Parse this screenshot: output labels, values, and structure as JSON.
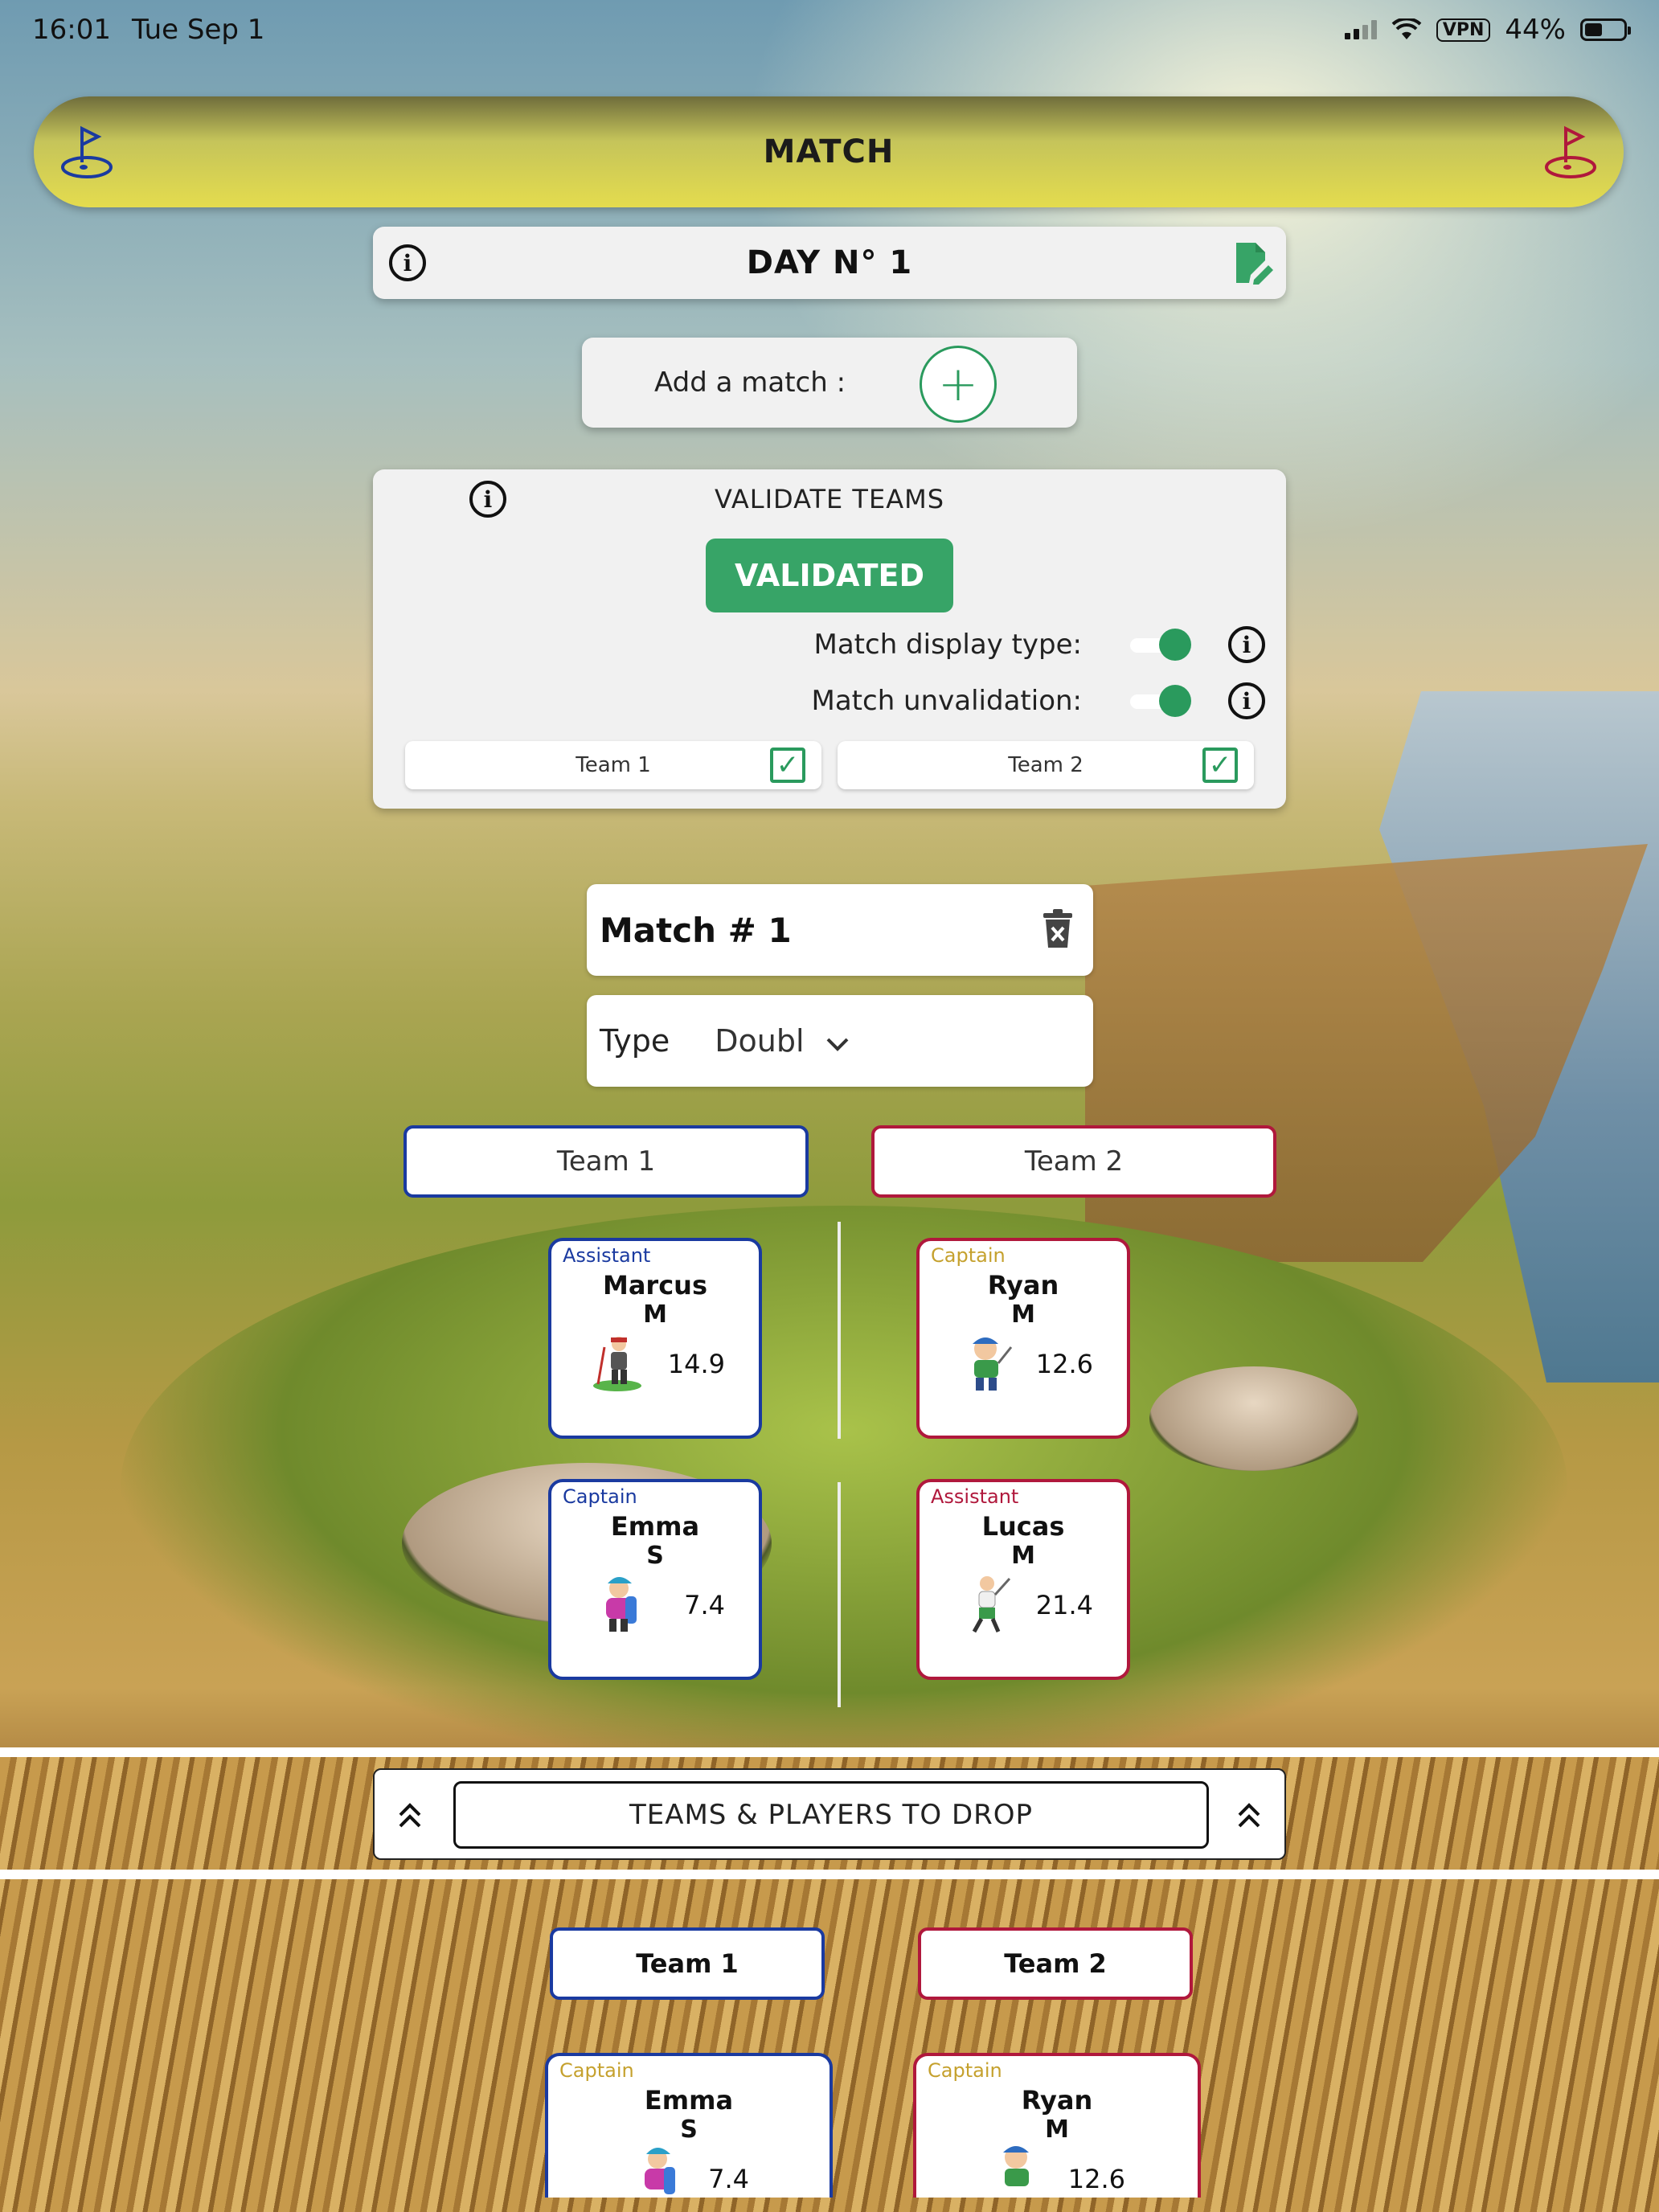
{
  "status_bar": {
    "time": "16:01",
    "date": "Tue Sep 1",
    "vpn": "VPN",
    "battery": "44%"
  },
  "header": {
    "title": "MATCH",
    "left_icon": "flag-hole-icon",
    "right_icon": "flag-hole-icon",
    "left_icon_color": "#1a3aa0",
    "right_icon_color": "#b0183c"
  },
  "day": {
    "title": "DAY N° 1",
    "info": "i"
  },
  "add_match": {
    "label": "Add a match :",
    "button": "+"
  },
  "validate": {
    "title": "VALIDATE TEAMS",
    "info": "i",
    "button": "VALIDATED",
    "display_type_label": "Match display type:",
    "unvalidation_label": "Match unvalidation:",
    "team1": "Team 1",
    "team2": "Team 2",
    "check": "✓"
  },
  "match": {
    "title": "Match #  1",
    "type_label": "Type",
    "type_value": "Doubl"
  },
  "teams": {
    "team1": "Team 1",
    "team2": "Team 2",
    "team1_color": "#1a3aa0",
    "team2_color": "#b0183c"
  },
  "players": [
    {
      "role": "Assistant",
      "name": "Marcus",
      "initial": "M",
      "hcp": "14.9"
    },
    {
      "role": "Captain",
      "name": "Ryan",
      "initial": "M",
      "hcp": "12.6"
    },
    {
      "role": "Captain",
      "name": "Emma",
      "initial": "S",
      "hcp": "7.4"
    },
    {
      "role": "Assistant",
      "name": "Lucas",
      "initial": "M",
      "hcp": "21.4"
    }
  ],
  "drop": {
    "label": "TEAMS & PLAYERS TO DROP",
    "team1": "Team 1",
    "team2": "Team 2",
    "players": [
      {
        "role": "Captain",
        "name": "Emma",
        "initial": "S",
        "hcp": "7.4"
      },
      {
        "role": "Captain",
        "name": "Ryan",
        "initial": "M",
        "hcp": "12.6"
      }
    ]
  }
}
